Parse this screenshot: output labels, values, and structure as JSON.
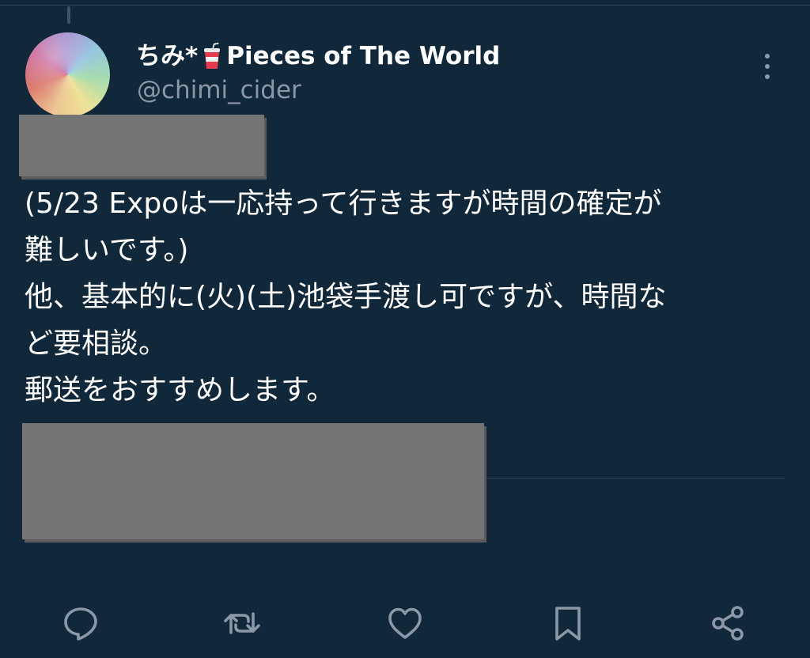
{
  "post": {
    "display_name": "ちみ*",
    "display_name_suffix": "Pieces of The World",
    "emoji_icon": "cup-with-straw-icon",
    "handle": "@chimi_cider",
    "text_lines": [
      "(5/23 Expoは一応持って行きますが時間の確定が",
      "難しいです。)",
      "他、基本的に(火)(土)池袋手渡し可ですが、時間な",
      "ど要相談。",
      "郵送をおすすめします。"
    ]
  },
  "actions": {
    "reply_icon": "reply-icon",
    "repost_icon": "repost-icon",
    "like_icon": "like-icon",
    "bookmark_icon": "bookmark-icon",
    "share_icon": "share-icon"
  },
  "colors": {
    "background": "#11273a",
    "text": "#ffffff",
    "muted": "#8b98a5",
    "redaction": "#747474"
  }
}
